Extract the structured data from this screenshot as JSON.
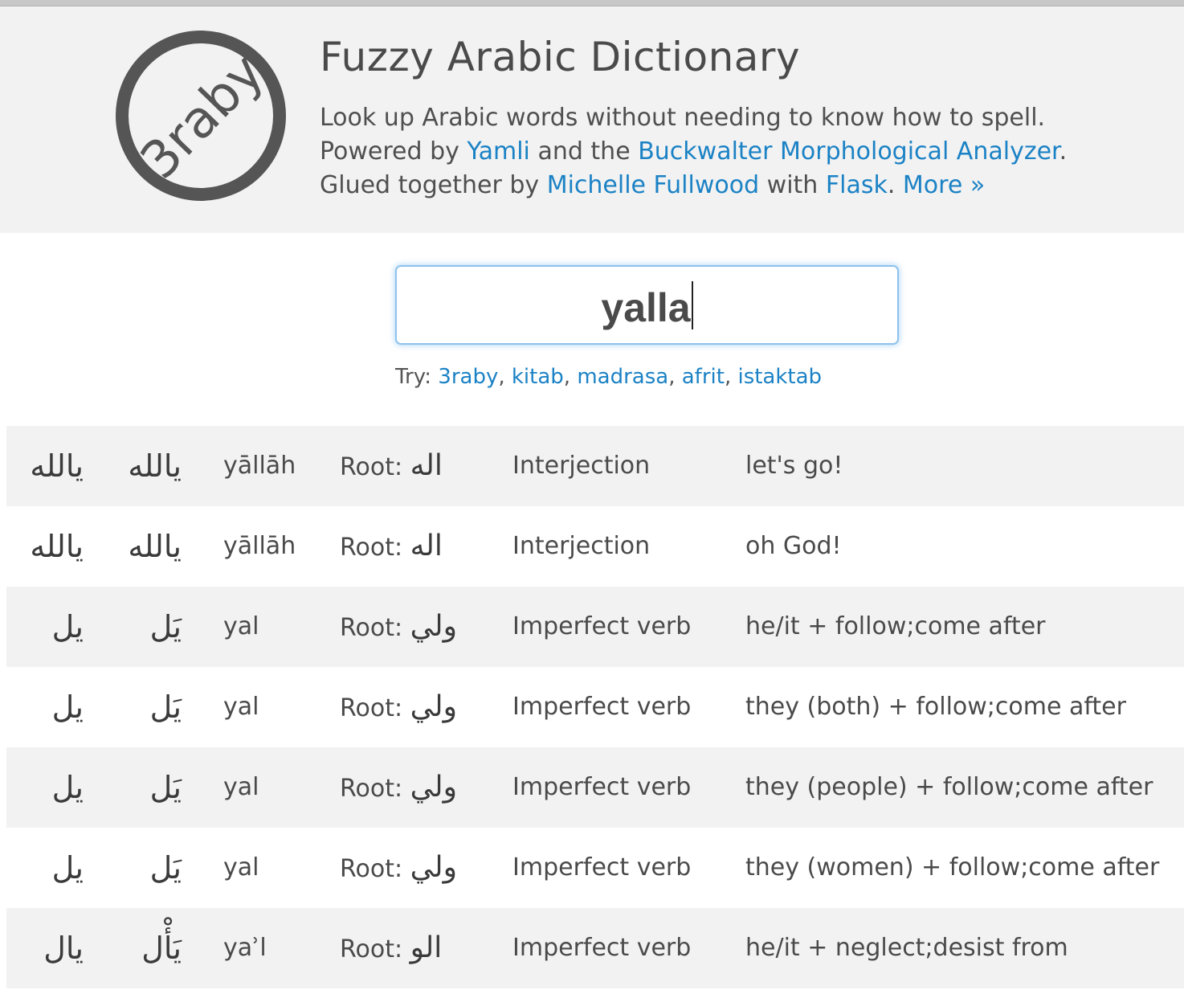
{
  "header": {
    "logo_text": "3raby",
    "title": "Fuzzy Arabic Dictionary",
    "line1": "Look up Arabic words without needing to know how to spell.",
    "line2_prefix": "Powered by ",
    "line2_link1": "Yamli",
    "line2_mid": " and the ",
    "line2_link2": "Buckwalter Morphological Analyzer",
    "line2_suffix": ".",
    "line3_prefix": "Glued together by ",
    "line3_link1": "Michelle Fullwood",
    "line3_mid": " with ",
    "line3_link2": "Flask",
    "line3_sep": ". ",
    "line3_link3": "More »"
  },
  "search": {
    "value": "yalla"
  },
  "try": {
    "label": "Try: ",
    "examples": [
      "3raby",
      "kitab",
      "madrasa",
      "afrit",
      "istaktab"
    ],
    "separator": ", "
  },
  "results": {
    "root_label": "Root: ",
    "rows": [
      {
        "bare": "يالله",
        "vocalized": "يالله",
        "translit": "yāllāh",
        "root": "اله",
        "pos": "Interjection",
        "definition": "let's go!"
      },
      {
        "bare": "يالله",
        "vocalized": "يالله",
        "translit": "yāllāh",
        "root": "اله",
        "pos": "Interjection",
        "definition": "oh God!"
      },
      {
        "bare": "يل",
        "vocalized": "يَل",
        "translit": "yal",
        "root": "ولي",
        "pos": "Imperfect verb",
        "definition": "he/it + follow;come after"
      },
      {
        "bare": "يل",
        "vocalized": "يَل",
        "translit": "yal",
        "root": "ولي",
        "pos": "Imperfect verb",
        "definition": "they (both) + follow;come after"
      },
      {
        "bare": "يل",
        "vocalized": "يَل",
        "translit": "yal",
        "root": "ولي",
        "pos": "Imperfect verb",
        "definition": "they (people) + follow;come after"
      },
      {
        "bare": "يل",
        "vocalized": "يَل",
        "translit": "yal",
        "root": "ولي",
        "pos": "Imperfect verb",
        "definition": "they (women) + follow;come after"
      },
      {
        "bare": "يال",
        "vocalized": "يَأْل",
        "translit": "yaʾl",
        "root": "الو",
        "pos": "Imperfect verb",
        "definition": "he/it + neglect;desist from"
      }
    ]
  },
  "colors": {
    "link": "#1b82c5",
    "header_bg": "#f2f2f2",
    "stripe_bg": "#f2f2f2",
    "logo": "#555555",
    "search_focus": "#8fc2ec"
  }
}
